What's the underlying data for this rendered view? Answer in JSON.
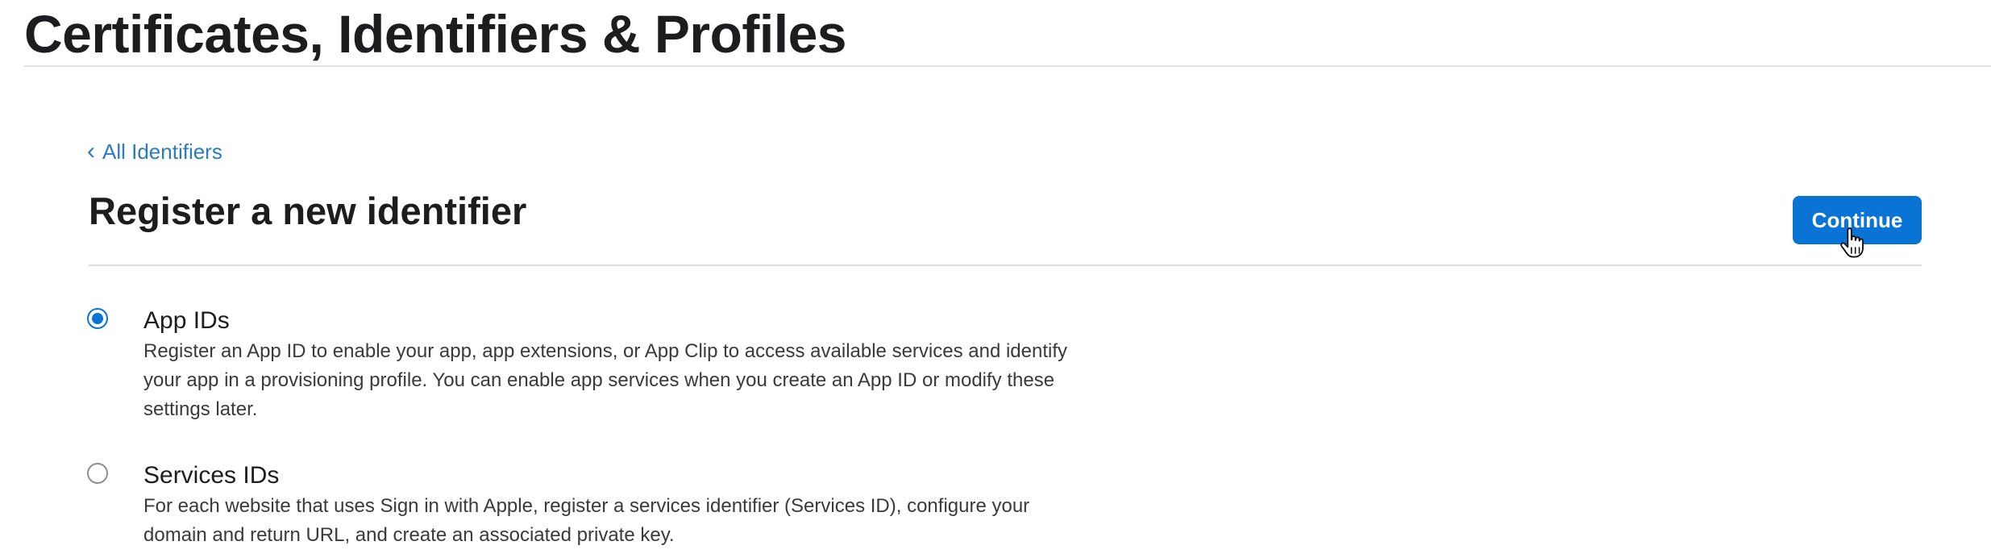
{
  "header": {
    "title": "Certificates, Identifiers & Profiles"
  },
  "nav": {
    "back_link": "All Identifiers",
    "back_icon": "chevron-left-icon"
  },
  "main": {
    "title": "Register a new identifier",
    "continue_label": "Continue",
    "options": [
      {
        "title": "App IDs",
        "selected": true,
        "description_lines": [
          "Register an App ID to enable your app, app extensions, or App Clip to access available services and identify",
          "your app in a provisioning profile. You can enable app services when you create an App ID or modify these",
          "settings later."
        ]
      },
      {
        "title": "Services IDs",
        "selected": false,
        "description_lines": [
          "For each website that uses Sign in with Apple, register a services identifier (Services ID), configure your",
          "domain and return URL, and create an associated private key."
        ]
      }
    ]
  },
  "colors": {
    "accent": "#0a74d6",
    "link": "#2a7bbf",
    "text": "#1d1d1f"
  },
  "cursor": {
    "icon": "hand-pointer-icon"
  }
}
